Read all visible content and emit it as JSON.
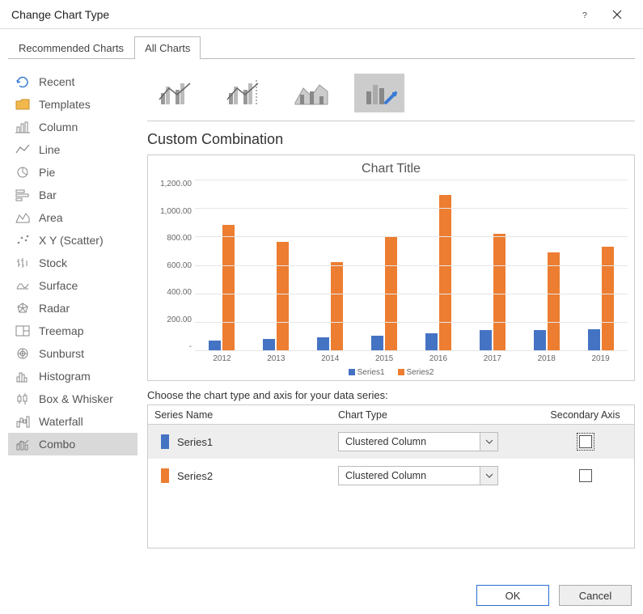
{
  "window": {
    "title": "Change Chart Type"
  },
  "tabs": {
    "recommended": "Recommended Charts",
    "all": "All Charts"
  },
  "sidebar": {
    "items": [
      {
        "label": "Recent"
      },
      {
        "label": "Templates"
      },
      {
        "label": "Column"
      },
      {
        "label": "Line"
      },
      {
        "label": "Pie"
      },
      {
        "label": "Bar"
      },
      {
        "label": "Area"
      },
      {
        "label": "X Y (Scatter)"
      },
      {
        "label": "Stock"
      },
      {
        "label": "Surface"
      },
      {
        "label": "Radar"
      },
      {
        "label": "Treemap"
      },
      {
        "label": "Sunburst"
      },
      {
        "label": "Histogram"
      },
      {
        "label": "Box & Whisker"
      },
      {
        "label": "Waterfall"
      },
      {
        "label": "Combo"
      }
    ]
  },
  "subtype": {
    "title": "Custom Combination"
  },
  "chart": {
    "title": "Chart Title",
    "legend": {
      "s1": "Series1",
      "s2": "Series2"
    }
  },
  "series_config": {
    "instruction": "Choose the chart type and axis for your data series:",
    "headers": {
      "name": "Series Name",
      "type": "Chart Type",
      "sec": "Secondary Axis"
    },
    "rows": [
      {
        "name": "Series1",
        "type": "Clustered Column",
        "color": "#4573c4",
        "secondary": false
      },
      {
        "name": "Series2",
        "type": "Clustered Column",
        "color": "#ed7d31",
        "secondary": false
      }
    ]
  },
  "buttons": {
    "ok": "OK",
    "cancel": "Cancel"
  },
  "chart_data": {
    "type": "bar",
    "title": "Chart Title",
    "xlabel": "",
    "ylabel": "",
    "ylim": [
      0,
      1200
    ],
    "yticks": [
      "-",
      "200.00",
      "400.00",
      "600.00",
      "800.00",
      "1,000.00",
      "1,200.00"
    ],
    "categories": [
      "2012",
      "2013",
      "2014",
      "2015",
      "2016",
      "2017",
      "2018",
      "2019"
    ],
    "series": [
      {
        "name": "Series1",
        "color": "#4573c4",
        "values": [
          70,
          80,
          90,
          100,
          120,
          140,
          140,
          150
        ]
      },
      {
        "name": "Series2",
        "color": "#ed7d31",
        "values": [
          880,
          760,
          620,
          800,
          1090,
          820,
          690,
          730
        ]
      }
    ]
  }
}
